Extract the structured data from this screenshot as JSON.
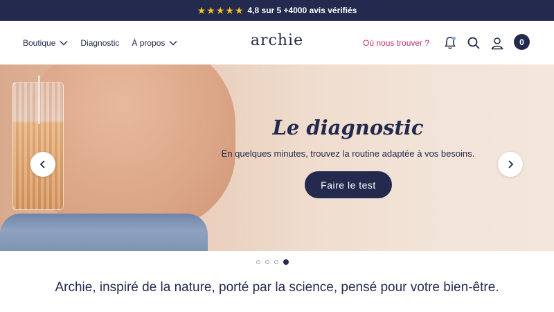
{
  "topbar": {
    "stars_count": 5,
    "rating_text": "4,8 sur 5 +4000 avis vérifiés",
    "star_color": "#f5c518",
    "background": "#232a4e"
  },
  "nav": {
    "items": [
      {
        "label": "Boutique",
        "has_dropdown": true
      },
      {
        "label": "Diagnostic",
        "has_dropdown": false
      },
      {
        "label": "À propos",
        "has_dropdown": true
      }
    ]
  },
  "logo": {
    "text": "archie"
  },
  "header_right": {
    "where_link": "Où nous trouver ?",
    "icons": [
      "bell-icon",
      "search-icon",
      "user-icon"
    ],
    "cart_count": "0"
  },
  "hero": {
    "title": "Le diagnostic",
    "subtitle": "En quelques minutes, trouvez la routine adaptée à vos besoins.",
    "cta_label": "Faire le test",
    "prev_icon": "chevron-left-icon",
    "next_icon": "chevron-right-icon"
  },
  "carousel": {
    "slides": 4,
    "active_index": 3
  },
  "tagline": "Archie, inspiré de la nature, porté par la science, pensé pour votre bien-être.",
  "colors": {
    "navy": "#232a4e",
    "accent_pink": "#c2306e"
  }
}
